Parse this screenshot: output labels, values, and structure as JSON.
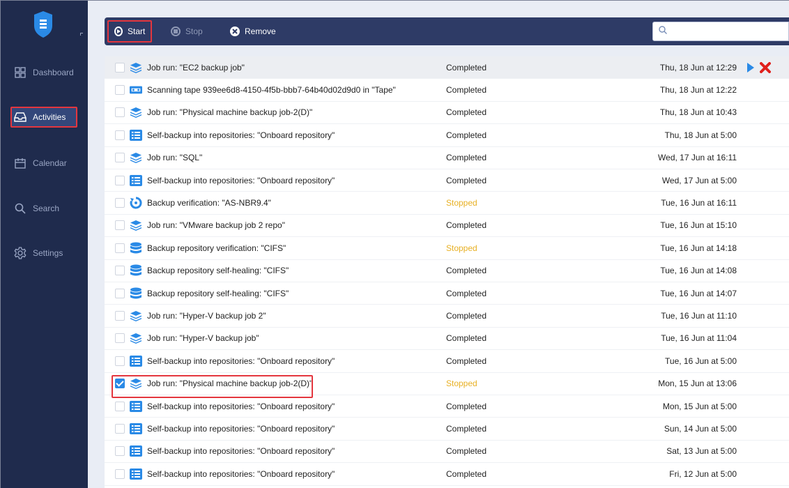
{
  "sidebar": {
    "items": [
      {
        "label": "Dashboard",
        "icon": "dashboard-icon"
      },
      {
        "label": "Activities",
        "icon": "inbox-icon",
        "active": true
      },
      {
        "label": "Calendar",
        "icon": "calendar-icon"
      },
      {
        "label": "Search",
        "icon": "search-icon"
      },
      {
        "label": "Settings",
        "icon": "gear-icon"
      }
    ]
  },
  "toolbar": {
    "start_label": "Start",
    "stop_label": "Stop",
    "remove_label": "Remove",
    "search_placeholder": ""
  },
  "colors": {
    "sidebar_bg": "#1f2b4d",
    "toolbar_bg": "#2e3b66",
    "highlight": "#e4363e",
    "stopped": "#e8b023",
    "icon_blue": "#2a8ae6",
    "delete_red": "#e0201c"
  },
  "activities": [
    {
      "icon": "job-icon",
      "name": "Job run: \"EC2 backup job\"",
      "status": "Completed",
      "date": "Thu, 18 Jun at 12:29",
      "checked": false
    },
    {
      "icon": "tape-icon",
      "name": "Scanning tape 939ee6d8-4150-4f5b-bbb7-64b40d02d9d0 in \"Tape\"",
      "status": "Completed",
      "date": "Thu, 18 Jun at 12:22",
      "checked": false
    },
    {
      "icon": "job-icon",
      "name": "Job run: \"Physical machine backup job-2(D)\"",
      "status": "Completed",
      "date": "Thu, 18 Jun at 10:43",
      "checked": false
    },
    {
      "icon": "self-backup-icon",
      "name": "Self-backup into repositories: \"Onboard repository\"",
      "status": "Completed",
      "date": "Thu, 18 Jun at 5:00",
      "checked": false
    },
    {
      "icon": "job-icon",
      "name": "Job run: \"SQL\"",
      "status": "Completed",
      "date": "Wed, 17 Jun at 16:11",
      "checked": false
    },
    {
      "icon": "self-backup-icon",
      "name": "Self-backup into repositories: \"Onboard repository\"",
      "status": "Completed",
      "date": "Wed, 17 Jun at 5:00",
      "checked": false
    },
    {
      "icon": "verification-icon",
      "name": "Backup verification: \"AS-NBR9.4\"",
      "status": "Stopped",
      "date": "Tue, 16 Jun at 16:11",
      "checked": false
    },
    {
      "icon": "job-icon",
      "name": "Job run: \"VMware backup job 2 repo\"",
      "status": "Completed",
      "date": "Tue, 16 Jun at 15:10",
      "checked": false
    },
    {
      "icon": "repository-icon",
      "name": "Backup repository verification: \"CIFS\"",
      "status": "Stopped",
      "date": "Tue, 16 Jun at 14:18",
      "checked": false
    },
    {
      "icon": "repository-icon",
      "name": "Backup repository self-healing: \"CIFS\"",
      "status": "Completed",
      "date": "Tue, 16 Jun at 14:08",
      "checked": false
    },
    {
      "icon": "repository-icon",
      "name": "Backup repository self-healing: \"CIFS\"",
      "status": "Completed",
      "date": "Tue, 16 Jun at 14:07",
      "checked": false
    },
    {
      "icon": "job-icon",
      "name": "Job run: \"Hyper-V backup job 2\"",
      "status": "Completed",
      "date": "Tue, 16 Jun at 11:10",
      "checked": false
    },
    {
      "icon": "job-icon",
      "name": "Job run: \"Hyper-V backup job\"",
      "status": "Completed",
      "date": "Tue, 16 Jun at 11:04",
      "checked": false
    },
    {
      "icon": "self-backup-icon",
      "name": "Self-backup into repositories: \"Onboard repository\"",
      "status": "Completed",
      "date": "Tue, 16 Jun at 5:00",
      "checked": false
    },
    {
      "icon": "job-icon",
      "name": "Job run: \"Physical machine backup job-2(D)\"",
      "status": "Stopped",
      "date": "Mon, 15 Jun at 13:06",
      "checked": true
    },
    {
      "icon": "self-backup-icon",
      "name": "Self-backup into repositories: \"Onboard repository\"",
      "status": "Completed",
      "date": "Mon, 15 Jun at 5:00",
      "checked": false
    },
    {
      "icon": "self-backup-icon",
      "name": "Self-backup into repositories: \"Onboard repository\"",
      "status": "Completed",
      "date": "Sun, 14 Jun at 5:00",
      "checked": false
    },
    {
      "icon": "self-backup-icon",
      "name": "Self-backup into repositories: \"Onboard repository\"",
      "status": "Completed",
      "date": "Sat, 13 Jun at 5:00",
      "checked": false
    },
    {
      "icon": "self-backup-icon",
      "name": "Self-backup into repositories: \"Onboard repository\"",
      "status": "Completed",
      "date": "Fri, 12 Jun at 5:00",
      "checked": false
    }
  ]
}
